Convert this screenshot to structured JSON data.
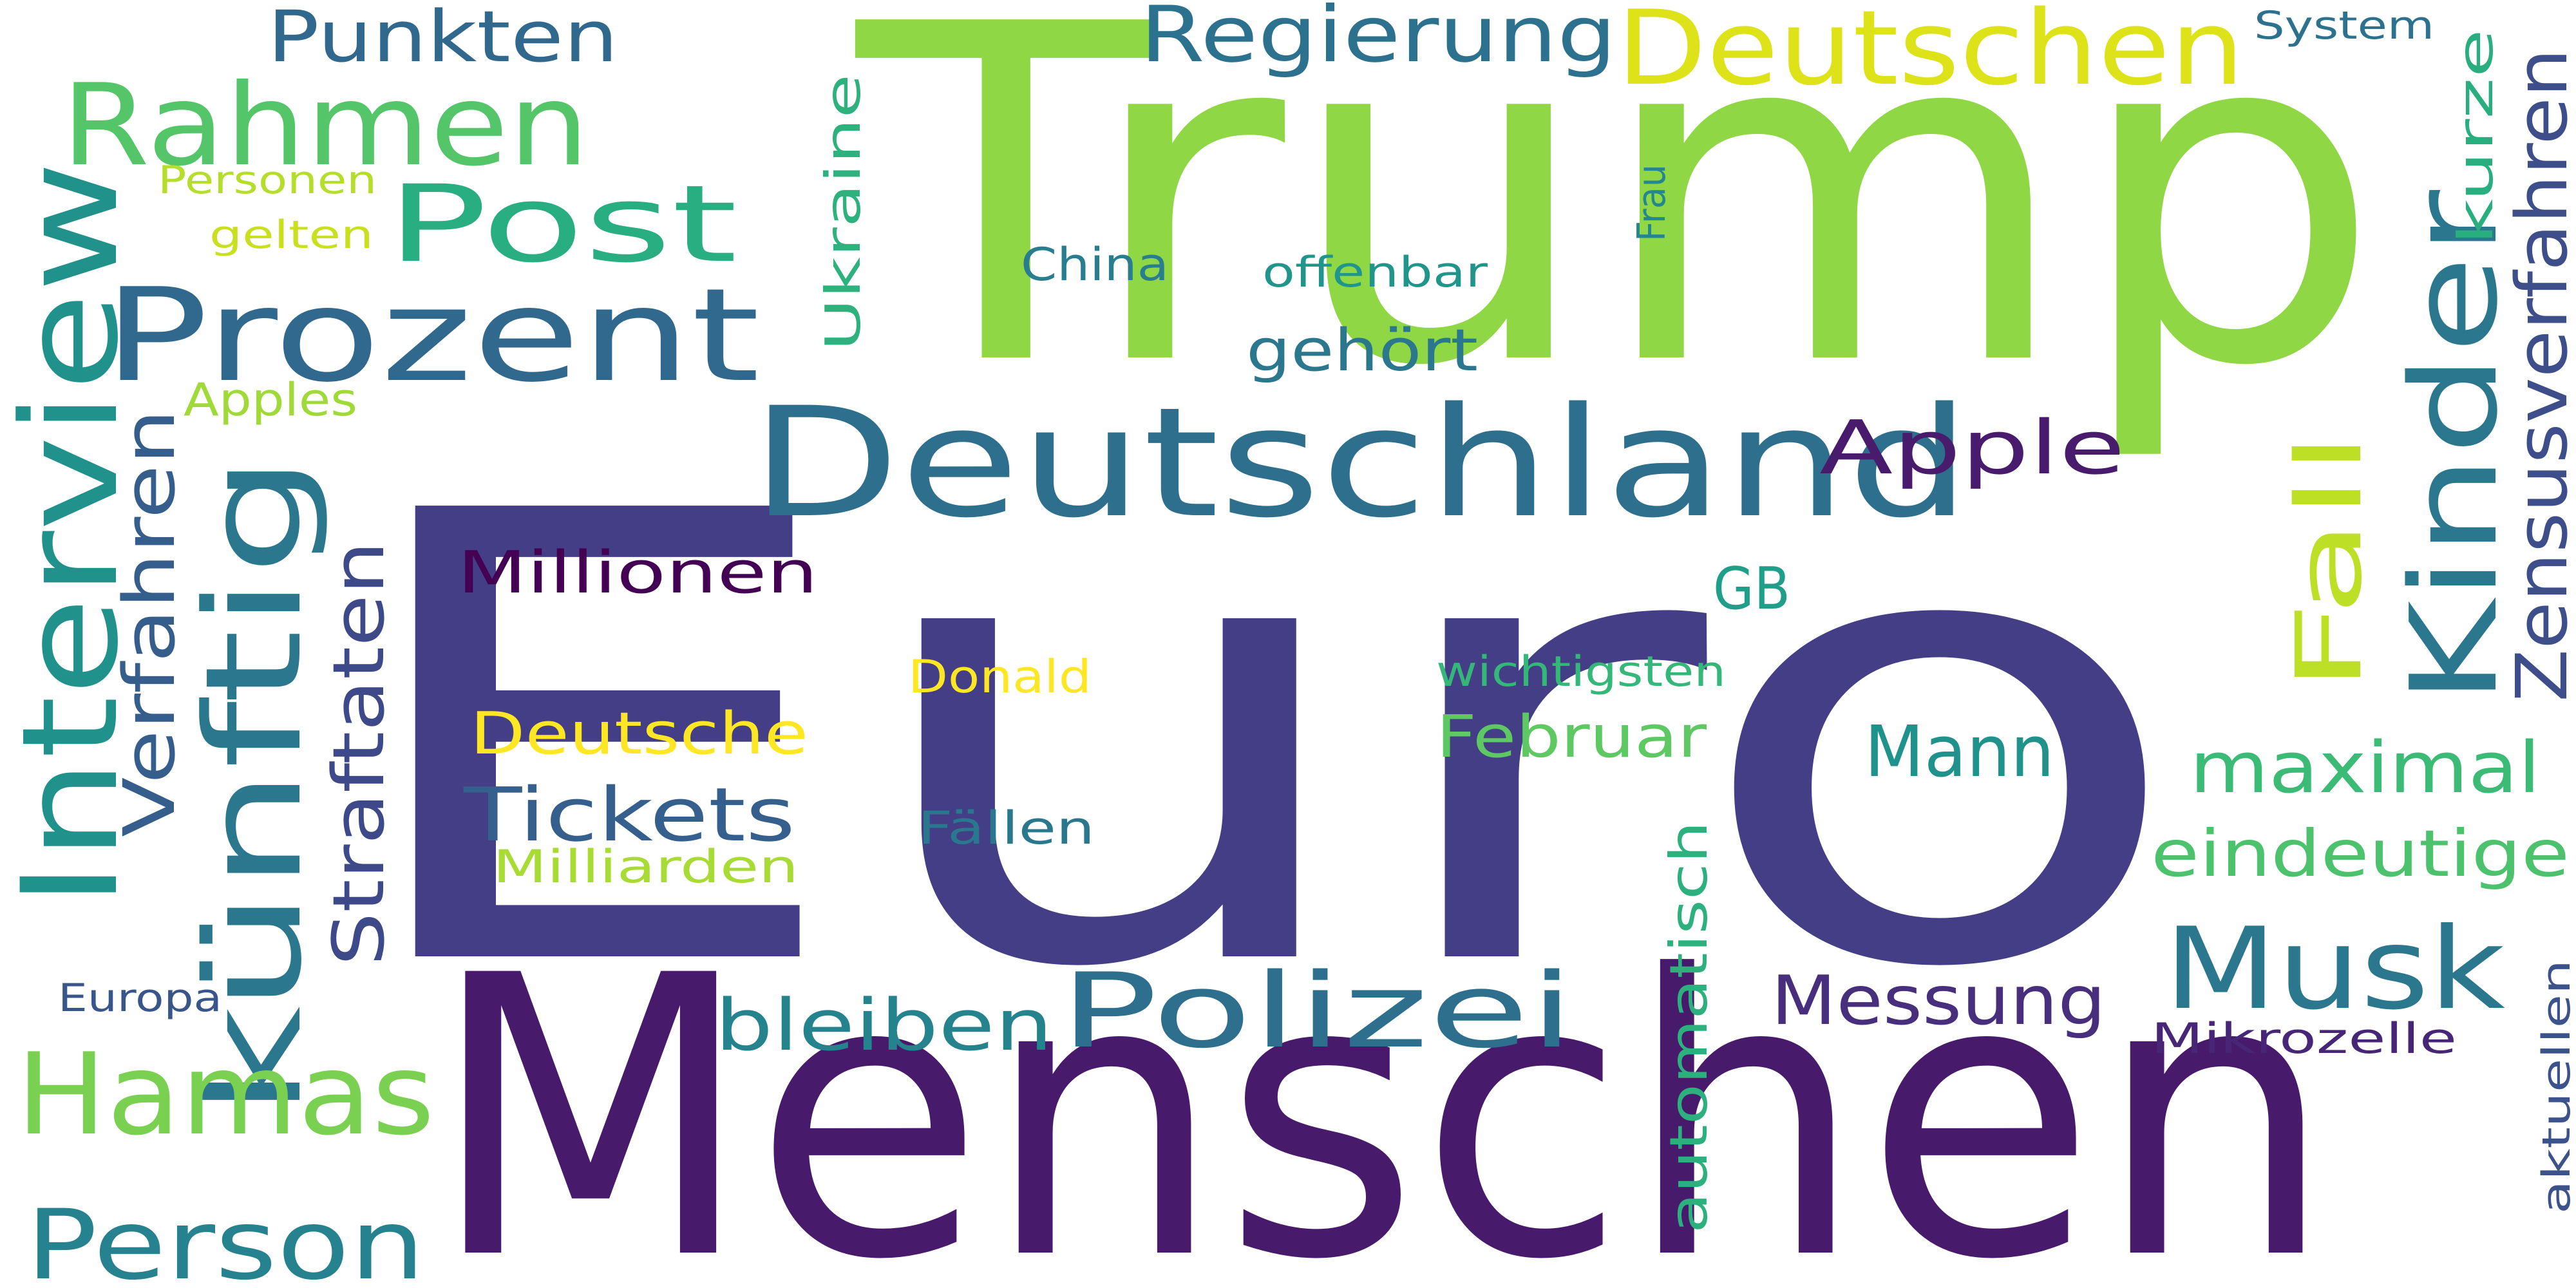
{
  "words": [
    {
      "text": "Euro",
      "color": "#433e85"
    },
    {
      "text": "Trump",
      "color": "#8fd744"
    },
    {
      "text": "Menschen",
      "color": "#471a6c"
    },
    {
      "text": "Deutschland",
      "color": "#2e6f8e"
    },
    {
      "text": "künftig",
      "color": "#2a778e"
    },
    {
      "text": "Interview",
      "color": "#21918c"
    },
    {
      "text": "Prozent",
      "color": "#31688e"
    },
    {
      "text": "Kinder",
      "color": "#2a778e"
    },
    {
      "text": "Rahmen",
      "color": "#54c568"
    },
    {
      "text": "Hamas",
      "color": "#7ad151"
    },
    {
      "text": "Musk",
      "color": "#2a778e"
    },
    {
      "text": "Post",
      "color": "#28ae80"
    },
    {
      "text": "Deutschen",
      "color": "#dde318"
    },
    {
      "text": "Polizei",
      "color": "#2e6f8e"
    },
    {
      "text": "Person",
      "color": "#26828e"
    },
    {
      "text": "Fall",
      "color": "#bddf26"
    },
    {
      "text": "Regierung",
      "color": "#2c718e"
    },
    {
      "text": "Zensusverfahren",
      "color": "#3d4e8a"
    },
    {
      "text": "Punkten",
      "color": "#31688e"
    },
    {
      "text": "Verfahren",
      "color": "#355e8d"
    },
    {
      "text": "Straftaten",
      "color": "#3e4989"
    },
    {
      "text": "Tickets",
      "color": "#355f8d"
    },
    {
      "text": "Apple",
      "color": "#481b6d"
    },
    {
      "text": "maximal",
      "color": "#3bbb75"
    },
    {
      "text": "eindeutige",
      "color": "#4cc26c"
    },
    {
      "text": "Messung",
      "color": "#472f7d"
    },
    {
      "text": "Mann",
      "color": "#20928c"
    },
    {
      "text": "bleiben",
      "color": "#25838e"
    },
    {
      "text": "automatisch",
      "color": "#2cb17e"
    },
    {
      "text": "Millionen",
      "color": "#440154"
    },
    {
      "text": "Deutsche",
      "color": "#fde725"
    },
    {
      "text": "Februar",
      "color": "#5ec962"
    },
    {
      "text": "Ukraine",
      "color": "#2db27d"
    },
    {
      "text": "kurze",
      "color": "#29af7f"
    },
    {
      "text": "Mikrozelle",
      "color": "#482677"
    },
    {
      "text": "gehört",
      "color": "#2a778e"
    },
    {
      "text": "GB",
      "color": "#1f9e89"
    },
    {
      "text": "wichtigsten",
      "color": "#35b779"
    },
    {
      "text": "offenbar",
      "color": "#1f958b"
    },
    {
      "text": "China",
      "color": "#287d8e"
    },
    {
      "text": "Fällen",
      "color": "#2a788e"
    },
    {
      "text": "Donald",
      "color": "#fde725"
    },
    {
      "text": "Milliarden",
      "color": "#a8db34"
    },
    {
      "text": "Apples",
      "color": "#a0da39"
    },
    {
      "text": "Personen",
      "color": "#b5de2b"
    },
    {
      "text": "gelten",
      "color": "#c8e020"
    },
    {
      "text": "Frau",
      "color": "#24868e"
    },
    {
      "text": "System",
      "color": "#2c728e"
    },
    {
      "text": "Europa",
      "color": "#39568c"
    },
    {
      "text": "aktuellen",
      "color": "#3b528b"
    }
  ]
}
